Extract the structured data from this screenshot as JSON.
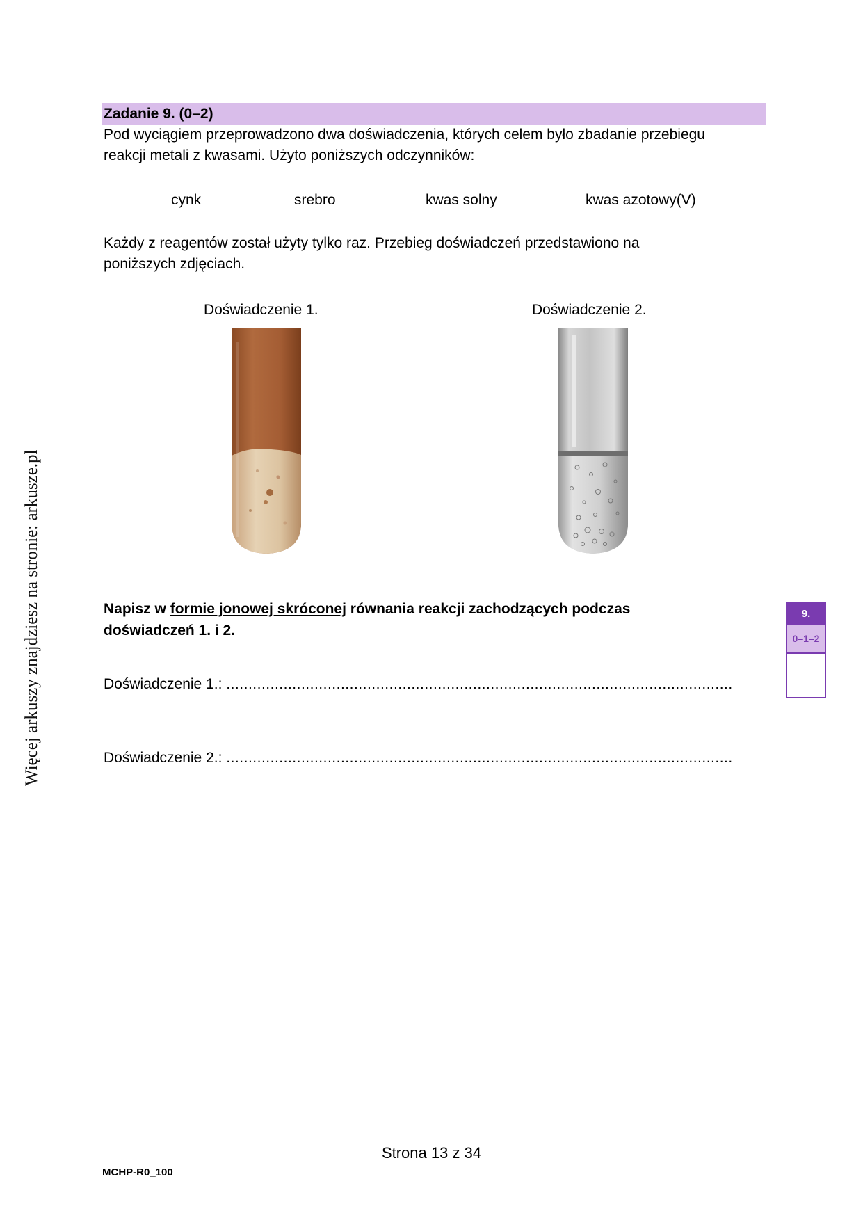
{
  "side_note": "Więcej arkuszy znajdziesz na stronie: arkusze.pl",
  "task": {
    "title": "Zadanie 9. (0–2)",
    "intro_line1": "Pod wyciągiem przeprowadzono dwa doświadczenia, których celem było zbadanie przebiegu",
    "intro_line2": "reakcji metali z kwasami. Użyto poniższych odczynników:",
    "reagents": [
      "cynk",
      "srebro",
      "kwas solny",
      "kwas azotowy(V)"
    ],
    "note_line1": "Każdy z reagentów został użyty tylko raz. Przebieg doświadczeń przedstawiono na",
    "note_line2": "poniższych zdjęciach.",
    "experiment1_title": "Doświadczenie 1.",
    "experiment2_title": "Doświadczenie 2.",
    "instruction_part1": "Napisz w ",
    "instruction_underlined": "formie jonowej skróconej",
    "instruction_part2": " równania reakcji zachodzących podczas",
    "instruction_line2": "doświadczeń 1. i 2.",
    "answer1_label": "Doświadczenie 1.:",
    "answer2_label": "Doświadczenie 2.:",
    "answer_dots": "..................................................................................................................."
  },
  "score": {
    "number": "9.",
    "points": "0–1–2"
  },
  "footer": {
    "page": "Strona 13 z 34",
    "code": "MCHP-R0_100"
  }
}
